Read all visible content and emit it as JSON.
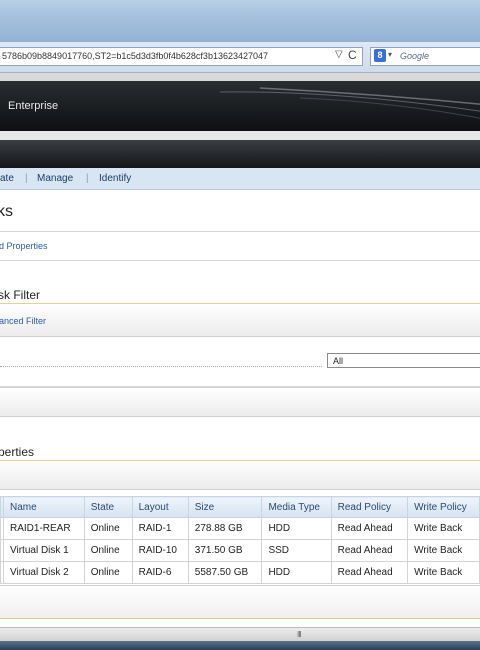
{
  "browser": {
    "url": "5786b09b8849017760,ST2=b1c5d3d3fb0f4b628cf3b13623427047",
    "search_engine_letter": "8",
    "search_placeholder": "Google",
    "reload_glyph": "C",
    "dropdown_glyph": "▽",
    "search_caret": "▾"
  },
  "app": {
    "brand": "Enterprise"
  },
  "tabs": [
    "ate",
    "Manage",
    "Identify"
  ],
  "tab_separator": "|",
  "page": {
    "title": "ks",
    "properties_link": "d Properties",
    "filter_section": "sk Filter",
    "advanced_filter_link": "anced Filter",
    "filter_select_value": "All",
    "properties_section": "perties"
  },
  "table": {
    "columns": [
      "Name",
      "State",
      "Layout",
      "Size",
      "Media Type",
      "Read Policy",
      "Write Policy"
    ],
    "rows": [
      [
        "RAID1-REAR",
        "Online",
        "RAID-1",
        "278.88 GB",
        "HDD",
        "Read Ahead",
        "Write Back"
      ],
      [
        "Virtual Disk 1",
        "Online",
        "RAID-10",
        "371.50 GB",
        "SSD",
        "Read Ahead",
        "Write Back"
      ],
      [
        "Virtual Disk 2",
        "Online",
        "RAID-6",
        "5587.50 GB",
        "HDD",
        "Read Ahead",
        "Write Back"
      ]
    ]
  },
  "scrollbar_grip": "III",
  "colors": {
    "header_dark": "#141619",
    "tab_bar": "#d8e5f3",
    "link_blue": "#2a5caa",
    "accent_gold": "#e8cf8e"
  }
}
